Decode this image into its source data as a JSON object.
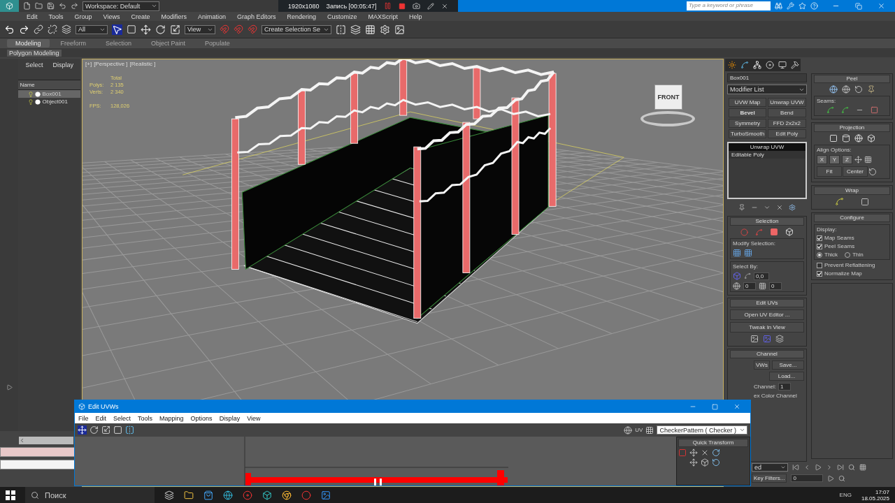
{
  "title_bar": {
    "workspace": "Workspace: Default",
    "recorder": {
      "resolution": "1920x1080",
      "status": "Запись [00:05:47]"
    },
    "search": {
      "placeholder": "Type a keyword or phrase"
    }
  },
  "menu": [
    "Edit",
    "Tools",
    "Group",
    "Views",
    "Create",
    "Modifiers",
    "Animation",
    "Graph Editors",
    "Rendering",
    "Customize",
    "MAXScript",
    "Help"
  ],
  "toolbar": {
    "selection_filter": "All",
    "reference_system": "View",
    "named_selection": "Create Selection Se"
  },
  "ribbon": {
    "tabs": [
      {
        "label": "Modeling",
        "selected": true
      },
      {
        "label": "Freeform",
        "selected": false
      },
      {
        "label": "Selection",
        "selected": false
      },
      {
        "label": "Object Paint",
        "selected": false
      },
      {
        "label": "Populate",
        "selected": false
      }
    ],
    "panel": "Polygon Modeling"
  },
  "scene_explorer": {
    "tabs": [
      "Select",
      "Display"
    ],
    "column": "Name",
    "items": [
      {
        "name": "Box001",
        "selected": true
      },
      {
        "name": "Object001",
        "selected": false
      }
    ]
  },
  "viewport": {
    "labels": [
      "[+]",
      "[Perspective ]",
      "[Realistic ]"
    ],
    "stats": {
      "heading": "Total",
      "rows": [
        {
          "label": "Polys:",
          "value": "2 135"
        },
        {
          "label": "Verts:",
          "value": "2 340"
        },
        {
          "label": "FPS:",
          "value": "128,026"
        }
      ]
    },
    "viewcube": "FRONT"
  },
  "command_panel": {
    "object_name": "Box001",
    "modifier_list": "Modifier List",
    "modifier_buttons": [
      "UVW Map",
      "Unwrap UVW",
      "Bevel",
      "Bend",
      "Symmetry",
      "FFD 2x2x2",
      "TurboSmooth",
      "Edit Poly"
    ],
    "stack": [
      {
        "name": "Unwrap UVW",
        "selected": true
      },
      {
        "name": "Editable Poly",
        "selected": false
      }
    ],
    "selection": {
      "title": "Selection",
      "modify_label": "Modify Selection:",
      "select_by_label": "Select By:",
      "angle": "0,0",
      "spinner_1": "0",
      "spinner_2": "0"
    },
    "edit_uvs": {
      "title": "Edit UVs",
      "buttons": [
        "Open UV Editor ...",
        "Tweak In View"
      ]
    },
    "channel": {
      "title": "Channel",
      "buttons": [
        "VWs",
        "Save...",
        "Load..."
      ],
      "map_channel_label": "Channel:",
      "map_channel": "1",
      "vertex_color_label": "ex Color Channel"
    },
    "peel": {
      "title": "Peel",
      "seams_label": "Seams:"
    },
    "projection": {
      "title": "Projection",
      "align_label": "Align Options:",
      "axes": [
        "X",
        "Y",
        "Z"
      ],
      "buttons": [
        "Fit",
        "Center"
      ]
    },
    "wrap": {
      "title": "Wrap"
    },
    "configure": {
      "title": "Configure",
      "display_label": "Display:",
      "display_options": [
        {
          "label": "Map Seams",
          "checked": true
        },
        {
          "label": "Peel Seams",
          "checked": true
        }
      ],
      "thickness": [
        {
          "label": "Thick",
          "selected": true
        },
        {
          "label": "Thin",
          "selected": false
        }
      ],
      "options": [
        {
          "label": "Prevent Reflattening",
          "checked": false
        },
        {
          "label": "Normalize Map",
          "checked": true
        }
      ]
    }
  },
  "time_controls": {
    "key_mode": "ed",
    "key_filters": "Key Filters...",
    "frame": "0"
  },
  "uv_editor": {
    "title": "Edit UVWs",
    "menu": [
      "File",
      "Edit",
      "Select",
      "Tools",
      "Mapping",
      "Options",
      "Display",
      "View"
    ],
    "label": "UV",
    "texture": "CheckerPattern  ( Checker )",
    "quick_transform": "Quick Transform"
  },
  "taskbar": {
    "search": "Поиск",
    "language": "ENG",
    "time": "17:07",
    "date": "18.05.2025"
  }
}
